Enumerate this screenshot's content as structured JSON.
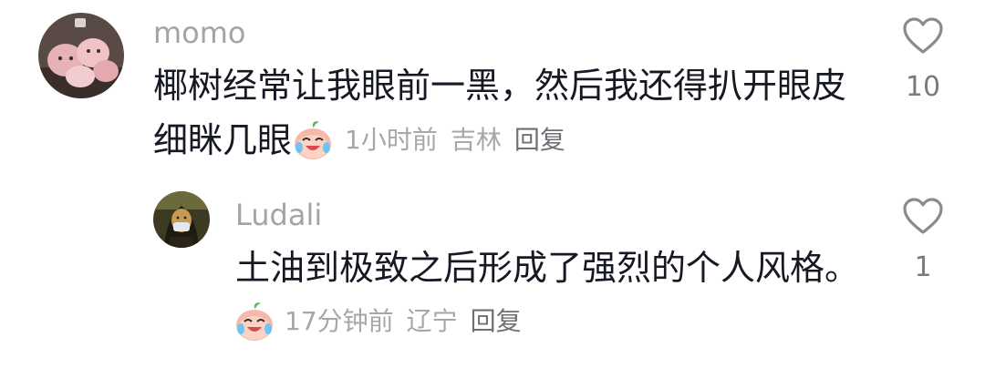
{
  "comments": [
    {
      "username": "momo",
      "text_line1": "椰树经常让我眼前一黑，然后我还得扒开眼皮",
      "text_line2": "细眯几眼",
      "emoji": "crying-laughing-peach-emoji",
      "time": "1小时前",
      "location": "吉林",
      "reply_label": "回复",
      "like_count": "10",
      "avatar": "pink-plush-toys-avatar",
      "like_icon": "heart-outline-icon"
    },
    {
      "username": "Ludali",
      "text_line1": "土油到极致之后形成了强烈的个人风格。",
      "emoji": "crying-laughing-peach-emoji",
      "time": "17分钟前",
      "location": "辽宁",
      "reply_label": "回复",
      "like_count": "1",
      "avatar": "mona-lisa-masked-avatar",
      "like_icon": "heart-outline-icon"
    }
  ],
  "colors": {
    "text": "#161823",
    "secondary": "#a3a3a8",
    "reply": "#6f6f75",
    "heart_outline": "#8a8a8f"
  }
}
